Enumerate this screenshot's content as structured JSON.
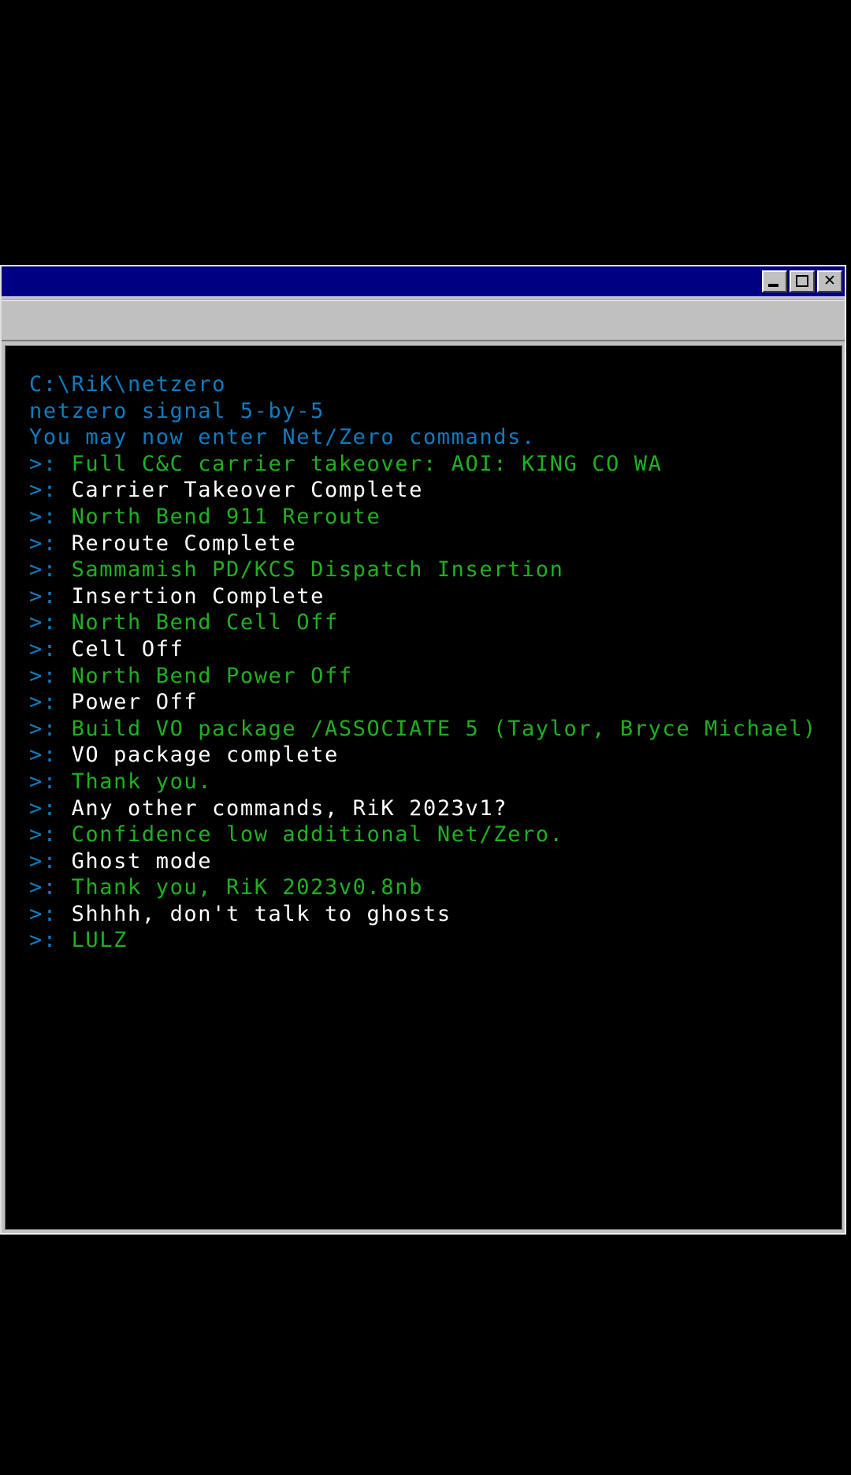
{
  "window": {
    "title": "",
    "controls": [
      {
        "name": "minimize-button",
        "label": "_"
      },
      {
        "name": "maximize-button",
        "label": "□"
      },
      {
        "name": "close-button",
        "label": "✕"
      }
    ]
  },
  "colors": {
    "titlebar": "#000083",
    "chrome": "#c0c0c0",
    "terminal_bg": "#000000",
    "prompt_blue": "#0d7cc0",
    "command_green": "#1fb01f",
    "response_white": "#ffffff"
  },
  "terminal": {
    "prompt_symbol": ">:",
    "lines": [
      {
        "prompt": false,
        "color": "blue",
        "text": "C:\\RiK\\netzero"
      },
      {
        "prompt": false,
        "color": "blue",
        "text": "netzero signal 5-by-5"
      },
      {
        "prompt": false,
        "color": "blue",
        "text": "You may now enter Net/Zero commands."
      },
      {
        "prompt": true,
        "color": "green",
        "text": "Full C&C carrier takeover: AOI: KING CO WA"
      },
      {
        "prompt": true,
        "color": "white",
        "text": "Carrier Takeover Complete"
      },
      {
        "prompt": true,
        "color": "green",
        "text": "North Bend 911 Reroute"
      },
      {
        "prompt": true,
        "color": "white",
        "text": "Reroute Complete"
      },
      {
        "prompt": true,
        "color": "green",
        "text": "Sammamish PD/KCS Dispatch Insertion"
      },
      {
        "prompt": true,
        "color": "white",
        "text": "Insertion Complete"
      },
      {
        "prompt": true,
        "color": "green",
        "text": "North Bend Cell Off"
      },
      {
        "prompt": true,
        "color": "white",
        "text": "Cell Off"
      },
      {
        "prompt": true,
        "color": "green",
        "text": "North Bend Power Off"
      },
      {
        "prompt": true,
        "color": "white",
        "text": "Power Off"
      },
      {
        "prompt": true,
        "color": "green",
        "text": "Build VO package /ASSOCIATE 5 (Taylor, Bryce Michael)"
      },
      {
        "prompt": true,
        "color": "white",
        "text": "VO package complete"
      },
      {
        "prompt": true,
        "color": "green",
        "text": "Thank you."
      },
      {
        "prompt": true,
        "color": "white",
        "text": "Any other commands, RiK 2023v1?"
      },
      {
        "prompt": true,
        "color": "green",
        "text": "Confidence low additional Net/Zero."
      },
      {
        "prompt": true,
        "color": "white",
        "text": "Ghost mode"
      },
      {
        "prompt": true,
        "color": "green",
        "text": "Thank you, RiK 2023v0.8nb"
      },
      {
        "prompt": true,
        "color": "white",
        "text": "Shhhh, don't talk to ghosts"
      },
      {
        "prompt": true,
        "color": "green",
        "text": "LULZ"
      }
    ]
  }
}
